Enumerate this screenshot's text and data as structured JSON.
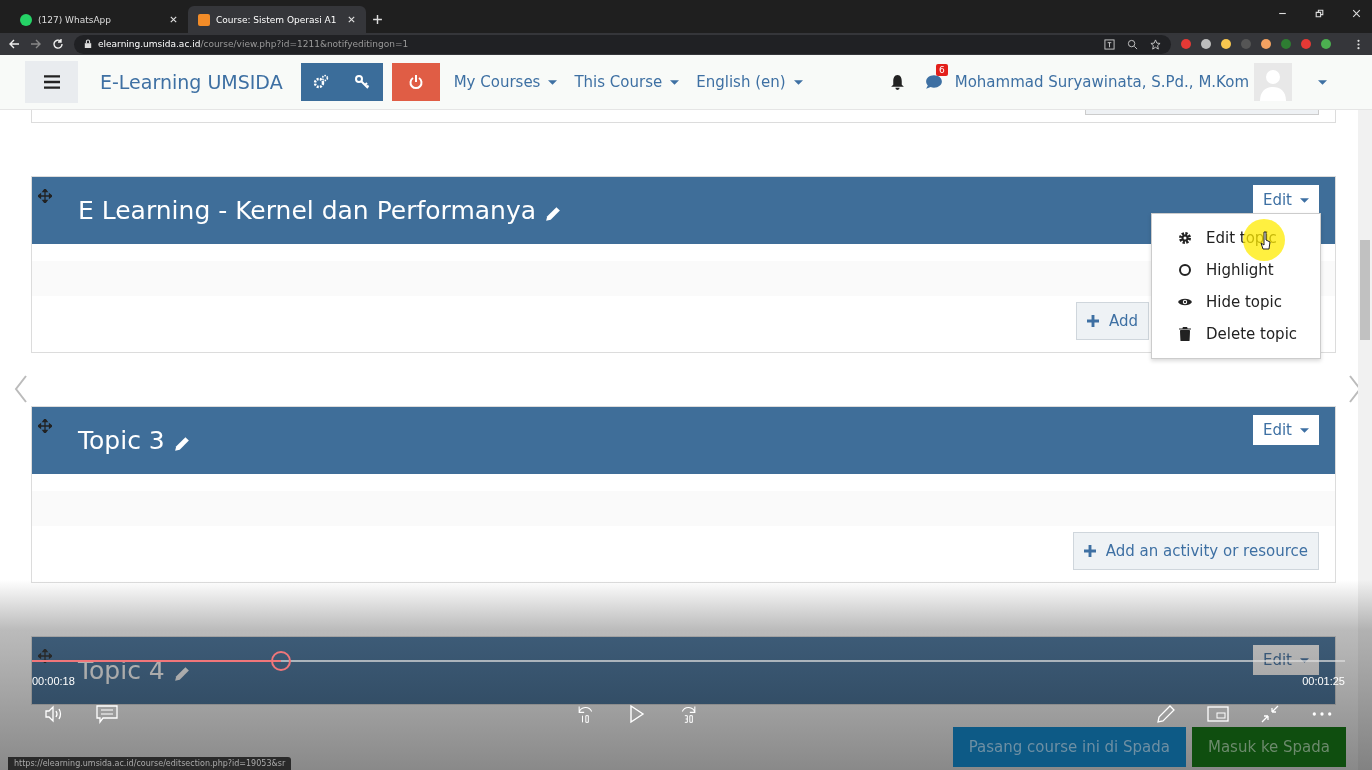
{
  "browser": {
    "tabs": [
      {
        "title": "(127) WhatsApp",
        "selected": false
      },
      {
        "title": "Course: Sistem Operasi A1",
        "selected": true
      }
    ],
    "url": {
      "host": "elearning.umsida.ac.id",
      "path": "/course/view.php?id=1211&notifyeditingon=1"
    }
  },
  "navbar": {
    "site_name": "E-Learning UMSIDA",
    "menus": [
      "My Courses",
      "This Course",
      "English (en)"
    ],
    "message_count": "6",
    "user": "Mohammad Suryawinata, S.Pd., M.Kom"
  },
  "sections": [
    {
      "title": "E Learning - Kernel dan Performanya",
      "edit_label": "Edit",
      "add_label": "Add",
      "menu": [
        {
          "label": "Edit topic",
          "kind": "gear"
        },
        {
          "label": "Highlight",
          "kind": "circle"
        },
        {
          "label": "Hide topic",
          "kind": "eye"
        },
        {
          "label": "Delete topic",
          "kind": "trash"
        }
      ]
    },
    {
      "title": "Topic 3",
      "edit_label": "Edit",
      "add_label": "Add an activity or resource"
    },
    {
      "title": "Topic 4",
      "edit_label": "Edit"
    }
  ],
  "player": {
    "current_time": "00:00:18",
    "total_time": "00:01:25",
    "level": 0.19
  },
  "floating_buttons": [
    {
      "label": "Pasang course ini di Spada",
      "kind": "blue"
    },
    {
      "label": "Masuk ke Spada",
      "kind": "green"
    }
  ],
  "status_url": "https://elearning.umsida.ac.id/course/editsection.php?id=19053&sr"
}
